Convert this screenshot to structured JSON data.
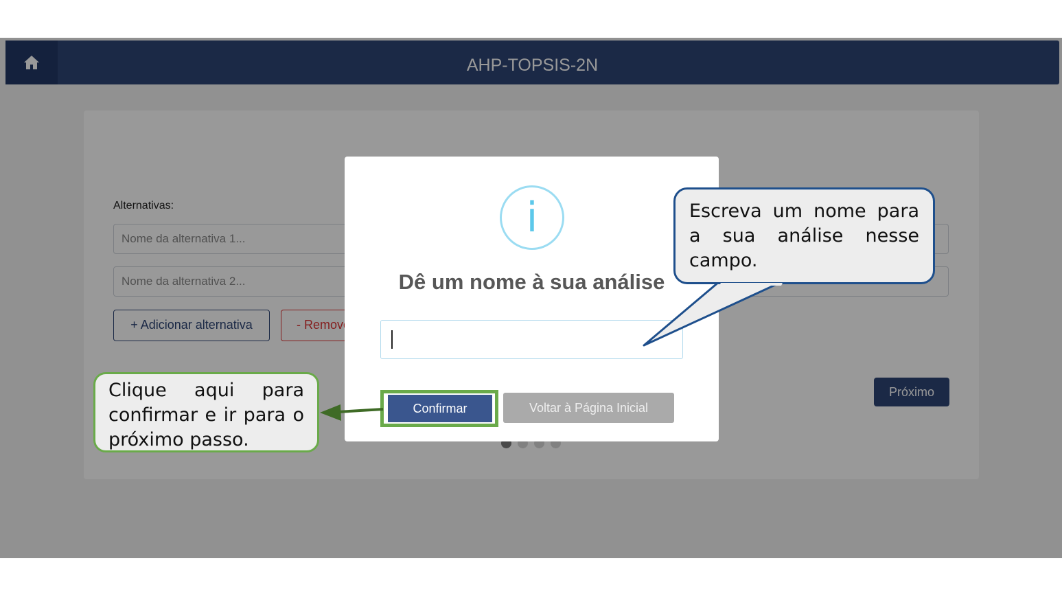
{
  "navbar": {
    "home_icon": "home-icon",
    "title": "AHP-TOPSIS-2N"
  },
  "form": {
    "alternatives_label": "Alternativas:",
    "inputs": [
      {
        "placeholder": "Nome da alternativa 1..."
      },
      {
        "placeholder": "Nome da alternativa 2..."
      }
    ],
    "add_button": "+ Adicionar alternativa",
    "remove_button": "- Remover alternativa",
    "next_button": "Próximo",
    "step_dots": 4,
    "active_step": 1
  },
  "modal": {
    "icon": "info-icon",
    "icon_glyph": "i",
    "title": "Dê um nome à sua análise",
    "input_value": "",
    "confirm_button": "Confirmar",
    "back_button": "Voltar à Página Inicial"
  },
  "annotations": {
    "blue_callout": "Escreva um nome para a sua análise nesse campo.",
    "green_callout": "Clique aqui para confirmar e ir para o próximo passo.",
    "colors": {
      "blue_border": "#1e4f8c",
      "green_border": "#6aaa4a"
    }
  },
  "colors": {
    "navbar": "#2e4576",
    "accent_info": "#5cc8ea",
    "danger": "#dd3333"
  }
}
